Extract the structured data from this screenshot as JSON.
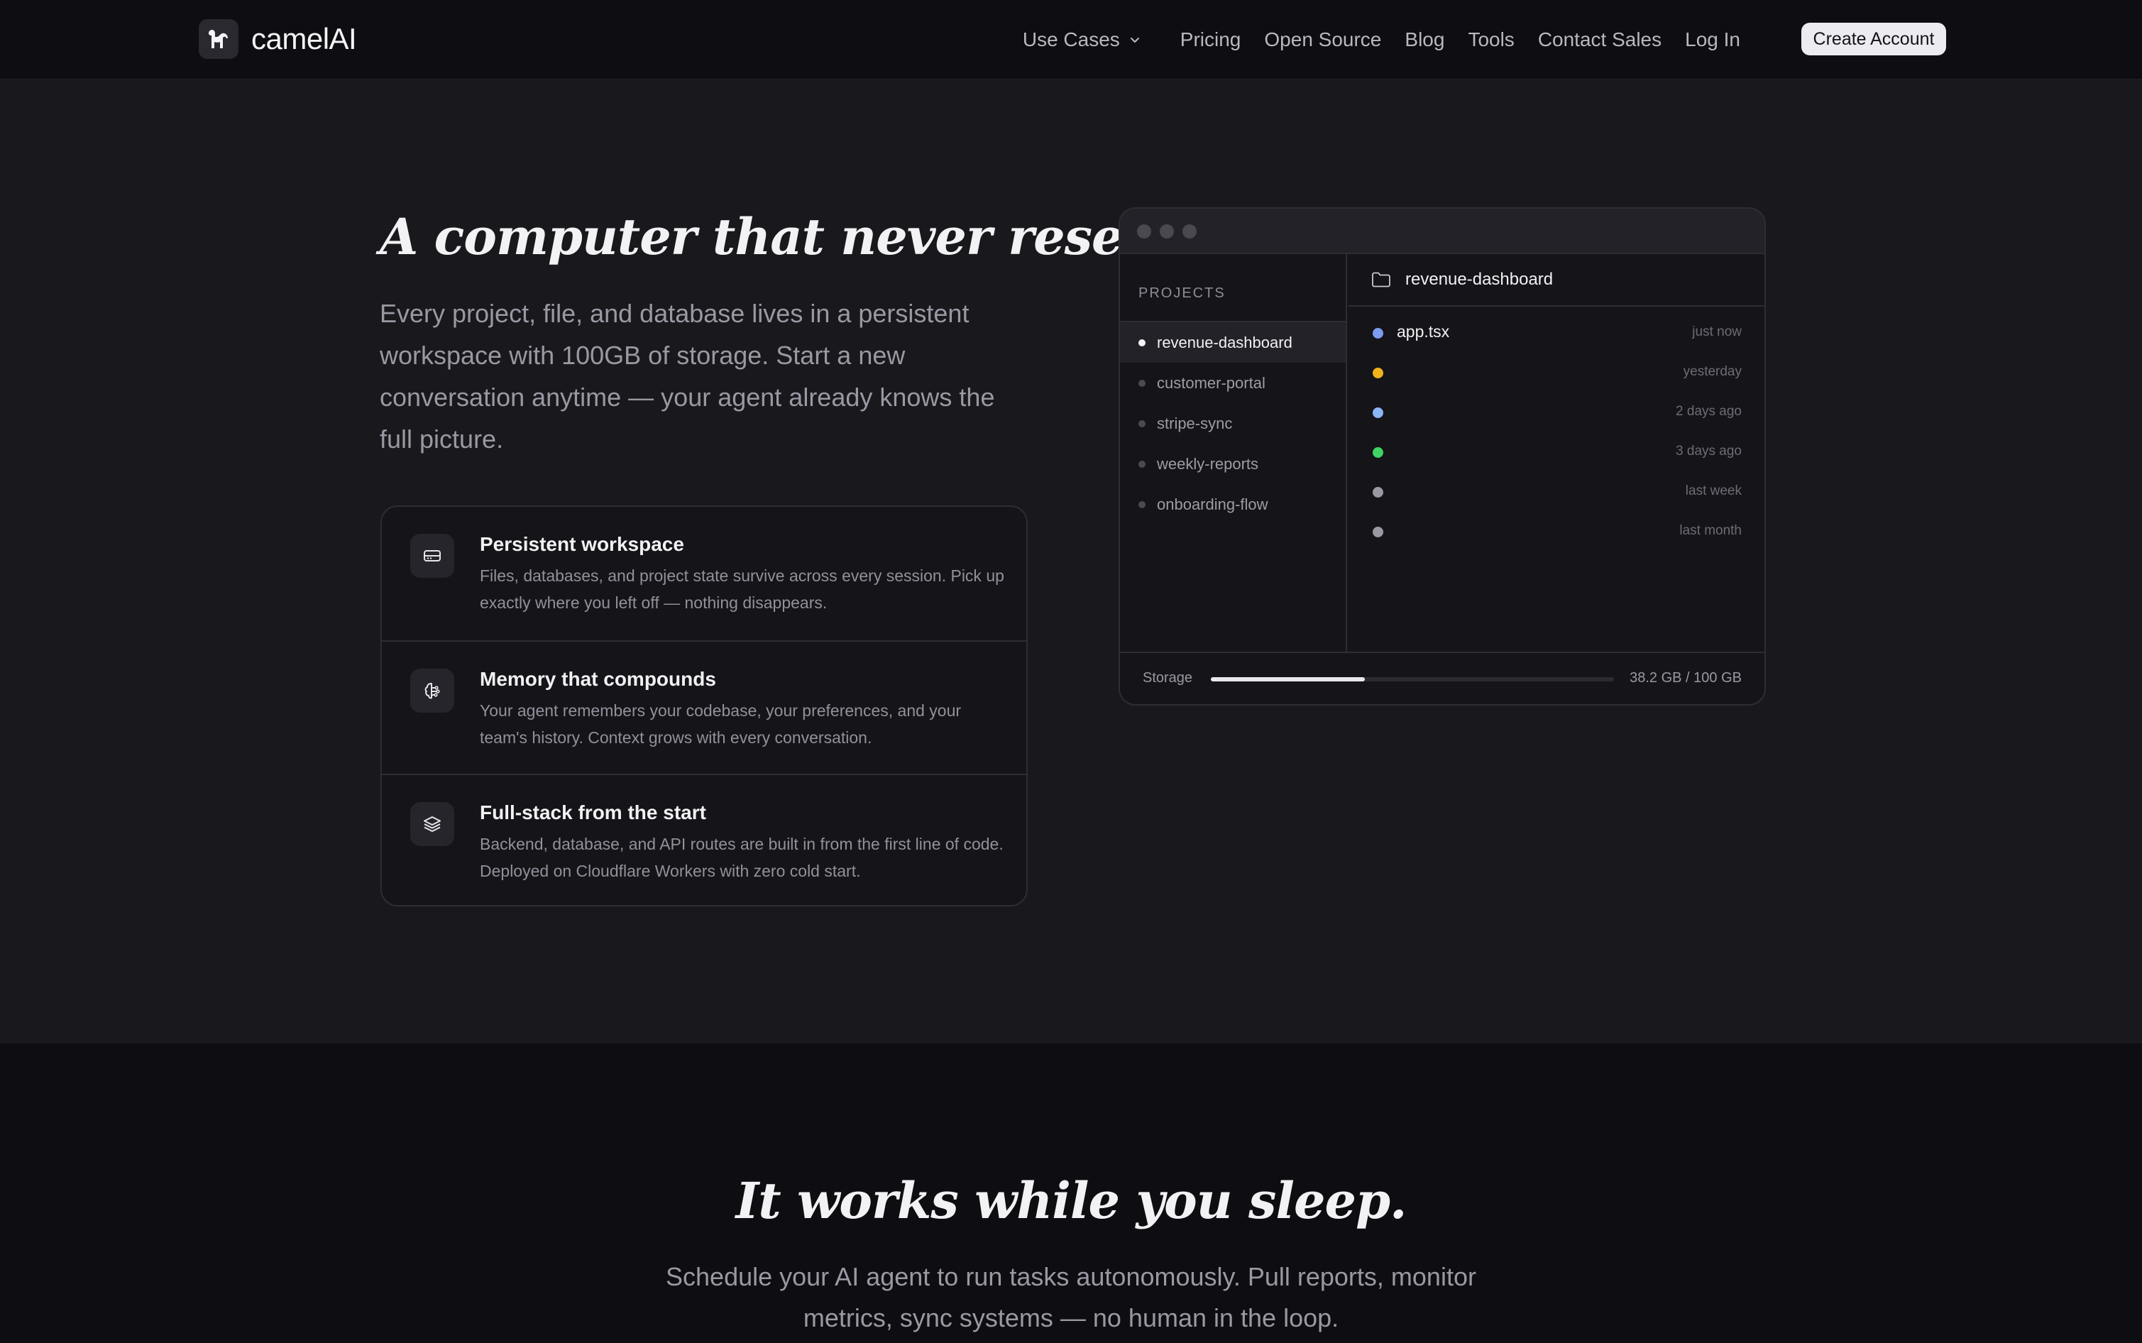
{
  "nav": {
    "brand": "camelAI",
    "links": [
      "Use Cases",
      "Pricing",
      "Open Source",
      "Blog",
      "Tools",
      "Contact Sales",
      "Log In"
    ],
    "cta": "Create Account"
  },
  "hero": {
    "title": "A computer that never resets.",
    "subtitle": "Every project, file, and database lives in a persistent workspace with 100GB of storage. Start a new conversation anytime — your agent already knows the full picture.",
    "features": [
      {
        "icon": "hard-drive-icon",
        "title": "Persistent workspace",
        "desc": "Files, databases, and project state survive across every session. Pick up exactly where you left off — nothing disappears."
      },
      {
        "icon": "brain-icon",
        "title": "Memory that compounds",
        "desc": "Your agent remembers your codebase, your preferences, and your team's history. Context grows with every conversation."
      },
      {
        "icon": "layers-icon",
        "title": "Full-stack from the start",
        "desc": "Backend, database, and API routes are built in from the first line of code. Deployed on Cloudflare Workers with zero cold start."
      }
    ]
  },
  "workspace": {
    "projects_heading": "PROJECTS",
    "projects": [
      "revenue-dashboard",
      "customer-portal",
      "stripe-sync",
      "weekly-reports",
      "onboarding-flow"
    ],
    "active_project": "revenue-dashboard",
    "files": [
      {
        "name": "app.tsx",
        "time": "just now",
        "color": "#7b9cf0"
      },
      {
        "name": "",
        "time": "yesterday",
        "color": "#f1b21c"
      },
      {
        "name": "",
        "time": "2 days ago",
        "color": "#8cb6f5"
      },
      {
        "name": "",
        "time": "3 days ago",
        "color": "#3fd463"
      },
      {
        "name": "",
        "time": "last week",
        "color": "#9a99a1"
      },
      {
        "name": "",
        "time": "last month",
        "color": "#9a99a1"
      }
    ],
    "storage_label": "Storage",
    "storage_value": "38.2 GB / 100 GB",
    "storage_fraction": 0.382
  },
  "section2": {
    "title": "It works while you sleep.",
    "subtitle": "Schedule your AI agent to run tasks autonomously. Pull reports, monitor metrics, sync systems — no human in the loop."
  }
}
